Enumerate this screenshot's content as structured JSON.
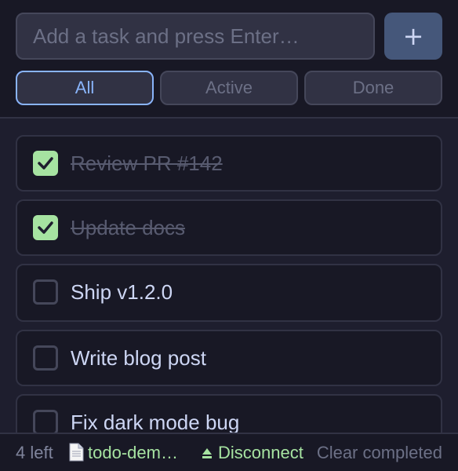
{
  "input": {
    "placeholder": "Add a task and press Enter…",
    "value": ""
  },
  "add_button": {
    "label": "+"
  },
  "filters": {
    "all": "All",
    "active": "Active",
    "done": "Done",
    "selected": "All"
  },
  "tasks": [
    {
      "label": "Review PR #142",
      "done": true
    },
    {
      "label": "Update docs",
      "done": true
    },
    {
      "label": "Ship v1.2.0",
      "done": false
    },
    {
      "label": "Write blog post",
      "done": false
    },
    {
      "label": "Fix dark mode bug",
      "done": false
    }
  ],
  "footer": {
    "count": "4 left",
    "file": "todo-dem…",
    "disconnect": "Disconnect",
    "clear": "Clear completed"
  },
  "colors": {
    "background": "#1e1e2e",
    "accent": "#89b4fa",
    "success": "#a6e3a1"
  }
}
